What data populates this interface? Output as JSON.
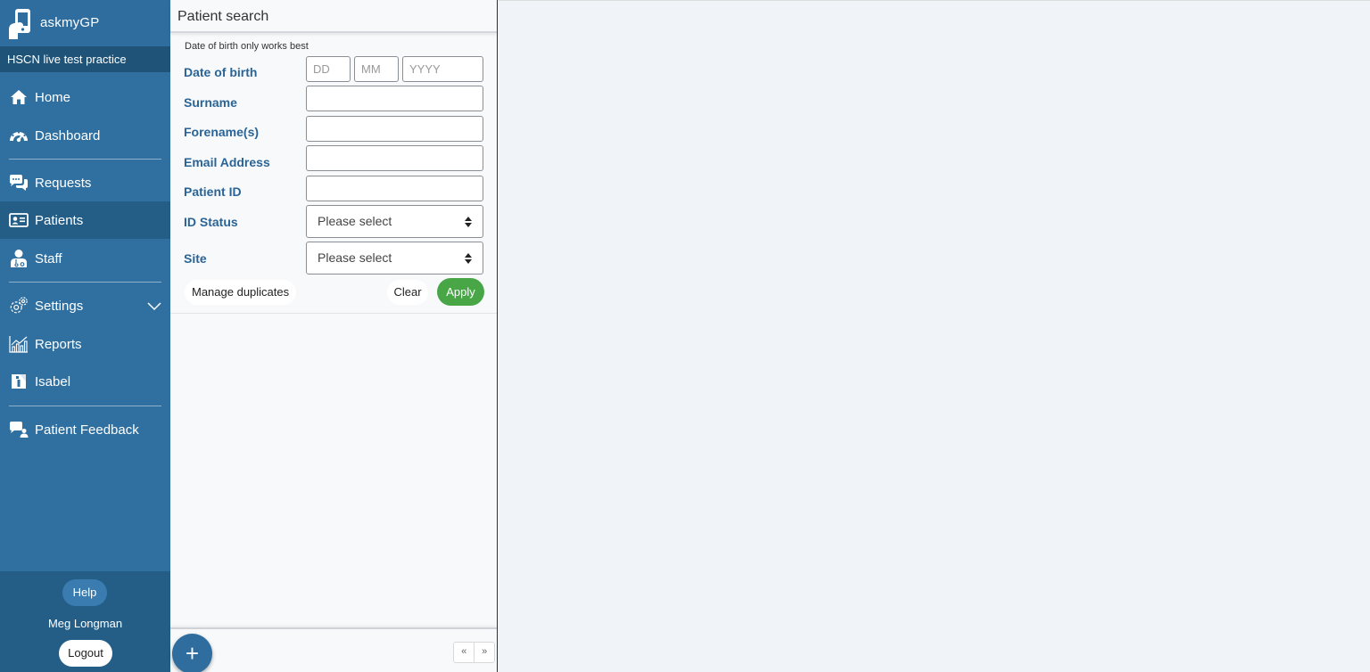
{
  "brand": {
    "name": "askmyGP"
  },
  "practice": {
    "name": "HSCN live test practice"
  },
  "sidebar": {
    "items": [
      {
        "label": "Home",
        "icon": "home-icon"
      },
      {
        "label": "Dashboard",
        "icon": "dashboard-icon"
      },
      {
        "label": "Requests",
        "icon": "chat-icon"
      },
      {
        "label": "Patients",
        "icon": "id-card-icon",
        "active": true
      },
      {
        "label": "Staff",
        "icon": "staff-icon"
      },
      {
        "label": "Settings",
        "icon": "gear-icon"
      },
      {
        "label": "Reports",
        "icon": "chart-icon"
      },
      {
        "label": "Isabel",
        "icon": "isabel-icon"
      },
      {
        "label": "Patient Feedback",
        "icon": "feedback-icon"
      }
    ],
    "help_label": "Help",
    "user_name": "Meg Longman",
    "logout_label": "Logout"
  },
  "search": {
    "title": "Patient search",
    "hint": "Date of birth only works best",
    "dob": {
      "label": "Date of birth",
      "dd_placeholder": "DD",
      "mm_placeholder": "MM",
      "yyyy_placeholder": "YYYY"
    },
    "surname": {
      "label": "Surname",
      "value": ""
    },
    "forename": {
      "label": "Forename(s)",
      "value": ""
    },
    "email": {
      "label": "Email Address",
      "value": ""
    },
    "patient_id": {
      "label": "Patient ID",
      "value": ""
    },
    "id_status": {
      "label": "ID Status",
      "selected": "Please select"
    },
    "site": {
      "label": "Site",
      "selected": "Please select"
    },
    "manage_duplicates_label": "Manage duplicates",
    "clear_label": "Clear",
    "apply_label": "Apply"
  },
  "panel_footer": {
    "add_label": "+",
    "pager_prev": "«",
    "pager_next": "»"
  },
  "colors": {
    "sidebar": "#3070a1",
    "sidebar_dark": "#1f5478",
    "label_blue": "#2a6496",
    "apply_green": "#48a646"
  }
}
